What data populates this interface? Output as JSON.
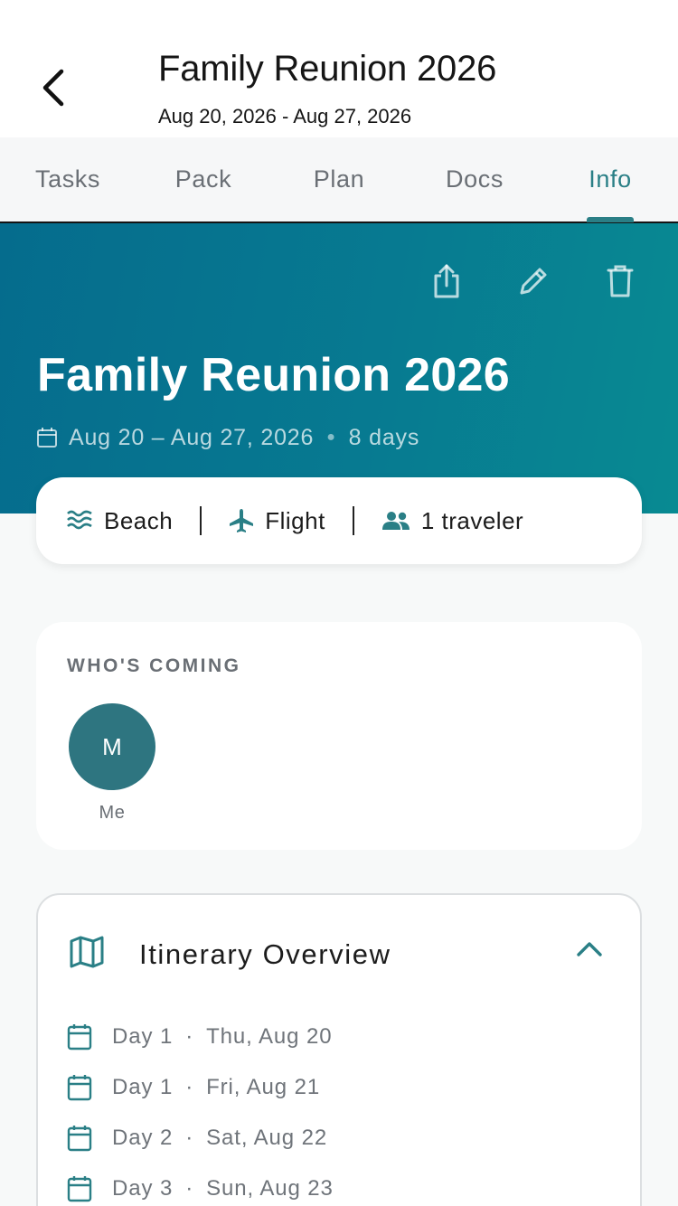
{
  "header": {
    "title": "Family Reunion 2026",
    "subtitle": "Aug 20, 2026 - Aug 27, 2026"
  },
  "tabs": [
    {
      "label": "Tasks",
      "active": false
    },
    {
      "label": "Pack",
      "active": false
    },
    {
      "label": "Plan",
      "active": false
    },
    {
      "label": "Docs",
      "active": false
    },
    {
      "label": "Info",
      "active": true
    }
  ],
  "hero": {
    "title": "Family Reunion 2026",
    "dates": "Aug 20 – Aug 27, 2026",
    "duration": "8 days",
    "actions": [
      "share-icon",
      "edit-icon",
      "delete-icon"
    ]
  },
  "summary": {
    "destination_type": "Beach",
    "transport": "Flight",
    "travelers": "1 traveler"
  },
  "whos_coming": {
    "label": "WHO'S COMING",
    "people": [
      {
        "initial": "M",
        "name": "Me"
      }
    ]
  },
  "itinerary": {
    "title": "Itinerary Overview",
    "expanded": true,
    "days": [
      {
        "day": "Day 1",
        "date": "Thu, Aug 20"
      },
      {
        "day": "Day 1",
        "date": "Fri, Aug 21"
      },
      {
        "day": "Day 2",
        "date": "Sat, Aug 22"
      },
      {
        "day": "Day 3",
        "date": "Sun, Aug 23"
      }
    ]
  },
  "colors": {
    "accent": "#2a7f86",
    "hero_start": "#056c8d",
    "hero_end": "#088a92",
    "avatar": "#2e7580",
    "muted_text": "#6a6f75"
  }
}
